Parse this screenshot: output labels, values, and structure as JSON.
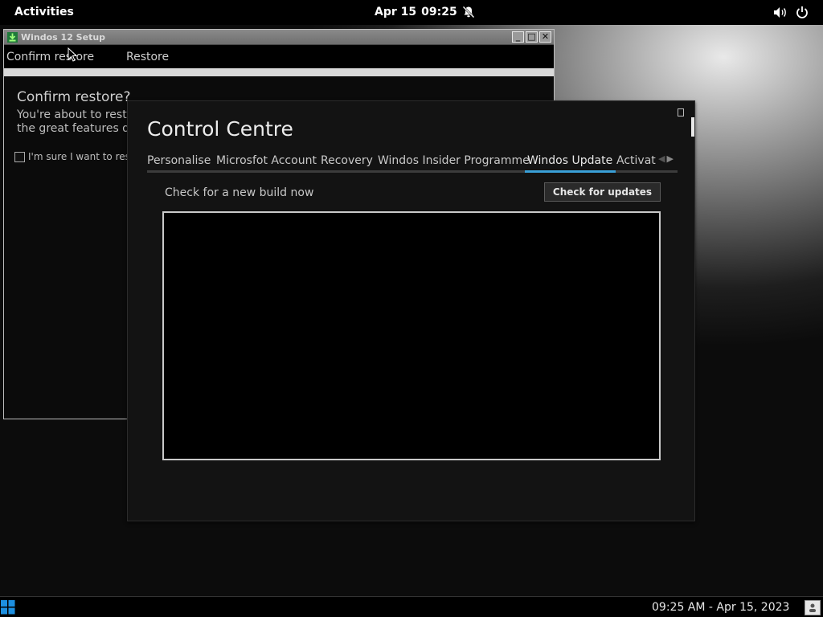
{
  "topbar": {
    "activities": "Activities",
    "date": "Apr 15",
    "time": "09:25",
    "icons": [
      "bell-off-icon",
      "volume-icon",
      "power-icon"
    ]
  },
  "setup_window": {
    "title": "Windos 12 Setup",
    "tabs": [
      "Confirm restore",
      "Restore"
    ],
    "heading": "Confirm restore?",
    "body_line1": "You're about to restore",
    "body_line2": "the great features of",
    "checkbox_label": "I'm sure I want to restore",
    "checkbox_checked": false
  },
  "control_centre": {
    "title": "Control Centre",
    "tabs": [
      {
        "label": "Personalise"
      },
      {
        "label": "Microsfot Account"
      },
      {
        "label": "Recovery"
      },
      {
        "label": "Windos Insider Programme"
      },
      {
        "label": "Windos Update",
        "active": true
      },
      {
        "label": "Activat"
      }
    ],
    "check_label": "Check for a new build now",
    "check_button": "Check for updates",
    "accent_color": "#3aa0d8"
  },
  "taskbar": {
    "clock": "09:25 AM - Apr 15, 2023"
  }
}
